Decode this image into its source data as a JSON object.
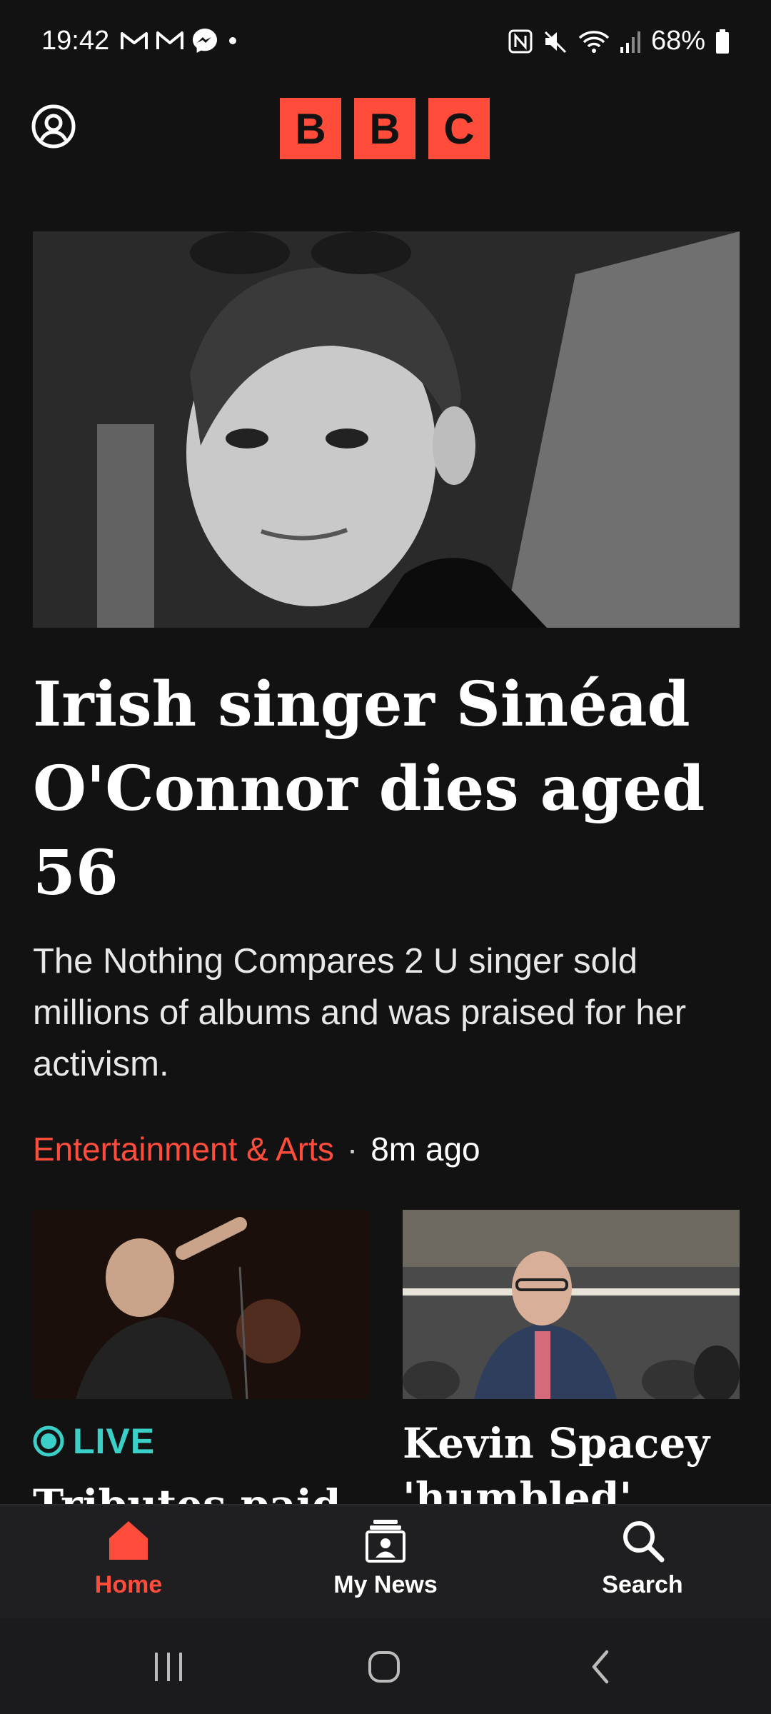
{
  "status_bar": {
    "time": "19:42",
    "battery": "68%",
    "left_icons": [
      "gmail-icon",
      "gmail-icon",
      "messenger-icon",
      "dot-icon"
    ],
    "right_icons": [
      "nfc-icon",
      "mute-icon",
      "wifi-icon",
      "signal-icon",
      "battery-icon"
    ]
  },
  "header": {
    "logo_letters": [
      "B",
      "B",
      "C"
    ],
    "brand_color": "#ff4c3b"
  },
  "hero": {
    "headline": "Irish singer Sinéad O'Connor dies aged 56",
    "summary": "The Nothing Compares 2 U singer sold millions of albums and was praised for her activism.",
    "category": "Entertainment & Arts",
    "separator": "·",
    "time_ago": "8m ago"
  },
  "cards": [
    {
      "badge": "LIVE",
      "title": "Tributes paid to"
    },
    {
      "title": "Kevin Spacey 'humbled' after"
    }
  ],
  "bottom_nav": {
    "items": [
      {
        "label": "Home",
        "icon": "home-icon",
        "active": true
      },
      {
        "label": "My News",
        "icon": "my-news-icon",
        "active": false
      },
      {
        "label": "Search",
        "icon": "search-icon",
        "active": false
      }
    ]
  },
  "colors": {
    "background": "#121213",
    "accent": "#ff4c3b",
    "live": "#3ad0c8"
  }
}
